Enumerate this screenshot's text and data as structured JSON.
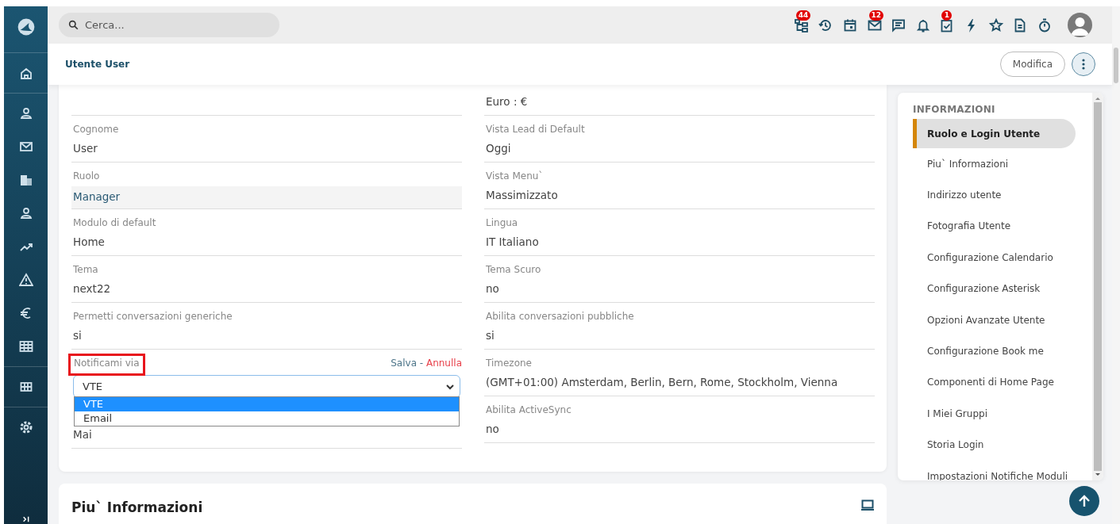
{
  "search": {
    "placeholder": "Cerca..."
  },
  "toolbar": [
    {
      "kind": "tree",
      "badge": "44"
    },
    {
      "kind": "history"
    },
    {
      "kind": "calendar"
    },
    {
      "kind": "mail",
      "badge": "12"
    },
    {
      "kind": "chat"
    },
    {
      "kind": "bell"
    },
    {
      "kind": "task",
      "badge": "1"
    },
    {
      "kind": "bolt"
    },
    {
      "kind": "star"
    },
    {
      "kind": "document"
    },
    {
      "kind": "stopwatch"
    }
  ],
  "header": {
    "title": "Utente User",
    "buttons": [
      "Modifica"
    ]
  },
  "fields": {
    "left": [
      {
        "kind": "text"
      },
      {
        "kind": "text",
        "label": "Cognome",
        "value": "User"
      },
      {
        "kind": "highlight",
        "label": "Ruolo",
        "value": "Manager"
      },
      {
        "kind": "text",
        "label": "Modulo di default",
        "value": "Home"
      },
      {
        "kind": "text",
        "label": "Tema",
        "value": "next22"
      },
      {
        "kind": "text",
        "label": "Permetti conversazioni generiche",
        "value": "si"
      },
      {
        "kind": "edit",
        "label": "Notificami via",
        "outlined": true,
        "save": "Salva",
        "separator": "-",
        "cancel": "Annulla",
        "value": "VTE",
        "expanded": true,
        "options": [
          {
            "label": "VTE",
            "selected": true
          },
          {
            "label": "Email",
            "selected": false
          }
        ]
      },
      {
        "kind": "text",
        "value": "Mai"
      }
    ],
    "right": [
      {
        "kind": "text",
        "value": "Euro : €"
      },
      {
        "kind": "text",
        "label": "Vista Lead di Default",
        "value": "Oggi"
      },
      {
        "kind": "text",
        "label": "Vista Menu`",
        "value": "Massimizzato"
      },
      {
        "kind": "text",
        "label": "Lingua",
        "value": "IT Italiano"
      },
      {
        "kind": "text",
        "label": "Tema Scuro",
        "value": "no"
      },
      {
        "kind": "text",
        "label": "Abilita conversazioni pubbliche",
        "value": "si"
      },
      {
        "kind": "text",
        "label": "Timezone",
        "value": "(GMT+01:00) Amsterdam, Berlin, Bern, Rome, Stockholm, Vienna"
      },
      {
        "kind": "text",
        "label": "Abilita ActiveSync",
        "value": "no"
      }
    ]
  },
  "section": {
    "title": "Piu` Informazioni"
  },
  "nav": {
    "title": "INFORMAZIONI",
    "items": [
      {
        "label": "Ruolo e Login Utente",
        "selected": true
      },
      {
        "label": "Piu` Informazioni",
        "selected": false
      },
      {
        "label": "Indirizzo utente",
        "selected": false
      },
      {
        "label": "Fotografia Utente",
        "selected": false
      },
      {
        "label": "Configurazione Calendario",
        "selected": false
      },
      {
        "label": "Configurazione Asterisk",
        "selected": false
      },
      {
        "label": "Opzioni Avanzate Utente",
        "selected": false
      },
      {
        "label": "Configurazione Book me",
        "selected": false
      },
      {
        "label": "Componenti di Home Page",
        "selected": false
      },
      {
        "label": "I Miei Gruppi",
        "selected": false
      },
      {
        "label": "Storia Login",
        "selected": false
      },
      {
        "label": "Impostazioni Notifiche Moduli",
        "selected": false
      }
    ]
  }
}
